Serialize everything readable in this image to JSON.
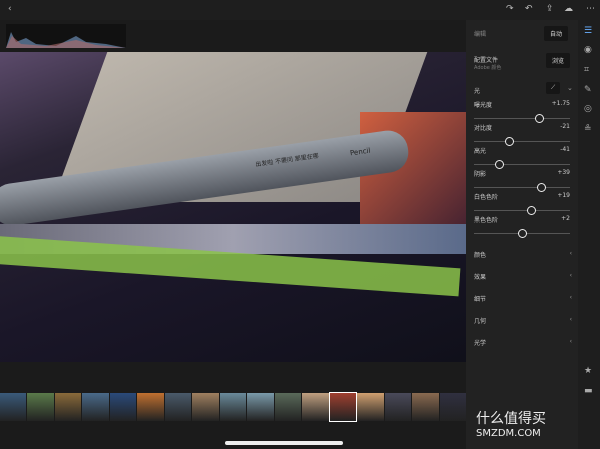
{
  "toolbar": {
    "back_icon": "chevron-left",
    "icons": [
      "redo",
      "undo",
      "share",
      "cloud",
      "more"
    ]
  },
  "panel": {
    "edit_label": "编辑",
    "auto_label": "自动",
    "profile_label": "配置文件",
    "profile_value": "Adobe 颜色",
    "browse_label": "浏览",
    "light_label": "光",
    "sliders": [
      {
        "label": "曝光度",
        "value": "+1.75",
        "position": 0.68
      },
      {
        "label": "对比度",
        "value": "-21",
        "position": 0.36
      },
      {
        "label": "高光",
        "value": "-41",
        "position": 0.26
      },
      {
        "label": "阴影",
        "value": "+39",
        "position": 0.7
      },
      {
        "label": "白色色阶",
        "value": "+19",
        "position": 0.59
      },
      {
        "label": "黑色色阶",
        "value": "+2",
        "position": 0.5
      }
    ],
    "sections": [
      "颜色",
      "效果",
      "细节",
      "几何",
      "光学"
    ]
  },
  "photo": {
    "text1": "出发啦 不要问 那里在哪",
    "text2": "Pencil"
  },
  "watermark": {
    "cn": "什么值得买",
    "en": "SMZDM.COM",
    "logo": "值"
  },
  "filmstrip": {
    "colors": [
      "#3a5a7a",
      "#5a7a4a",
      "#8a6a3a",
      "#4a6a8a",
      "#2a4a7a",
      "#c07030",
      "#4a5a6a",
      "#a08060",
      "#6a8a9a",
      "#7a9aaa",
      "#5a6a5a",
      "#c0a080",
      "#a04030",
      "#d0a070",
      "#4a4a5a",
      "#8a6a50",
      "#303040"
    ]
  }
}
